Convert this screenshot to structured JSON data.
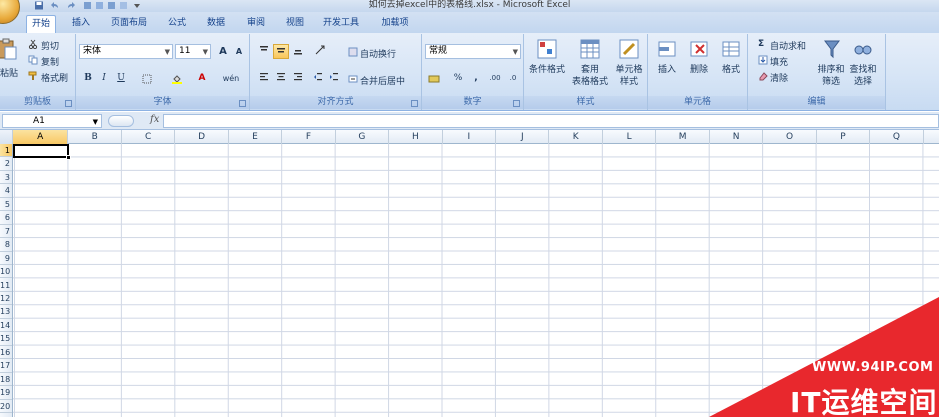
{
  "window": {
    "title": "如何去掉excel中的表格线.xlsx - Microsoft Excel"
  },
  "tabs": [
    "开始",
    "插入",
    "页面布局",
    "公式",
    "数据",
    "审阅",
    "视图",
    "开发工具",
    "加载项"
  ],
  "ribbon": {
    "clipboard": {
      "paste": "粘贴",
      "cut": "剪切",
      "copy": "复制",
      "format_painter": "格式刷",
      "label": "剪贴板"
    },
    "font": {
      "name": "宋体",
      "size": "11",
      "bold": "B",
      "italic": "I",
      "underline": "U",
      "grow": "A",
      "shrink": "A",
      "color_letter": "A",
      "phonetic": "wén",
      "label": "字体"
    },
    "alignment": {
      "wrap": "自动换行",
      "merge": "合并后居中",
      "label": "对齐方式"
    },
    "number": {
      "format": "常规",
      "percent": "%",
      "comma": ",",
      "inc": ".00",
      "dec": ".0",
      "label": "数字"
    },
    "styles": {
      "conditional": "条件格式",
      "table_l1": "套用",
      "table_l2": "表格格式",
      "cell_l1": "单元格",
      "cell_l2": "样式",
      "label": "样式"
    },
    "cells": {
      "insert": "插入",
      "delete": "删除",
      "format": "格式",
      "label": "单元格"
    },
    "editing": {
      "autosum": "自动求和",
      "fill": "填充",
      "clear": "清除",
      "sort_l1": "排序和",
      "sort_l2": "筛选",
      "find_l1": "查找和",
      "find_l2": "选择",
      "sigma": "Σ",
      "label": "编辑"
    }
  },
  "formula_bar": {
    "name_box": "A1",
    "fx": "fx",
    "value": ""
  },
  "columns": [
    "A",
    "B",
    "C",
    "D",
    "E",
    "F",
    "G",
    "H",
    "I",
    "J",
    "K",
    "L",
    "M",
    "N",
    "O",
    "P",
    "Q"
  ],
  "rows": [
    "1",
    "2",
    "3",
    "4",
    "5",
    "6",
    "7",
    "8",
    "9",
    "10",
    "11",
    "12",
    "13",
    "14",
    "15",
    "16",
    "17",
    "18",
    "19",
    "20"
  ],
  "watermark": {
    "url": "WWW.94IP.COM",
    "text": "IT运维空间"
  }
}
